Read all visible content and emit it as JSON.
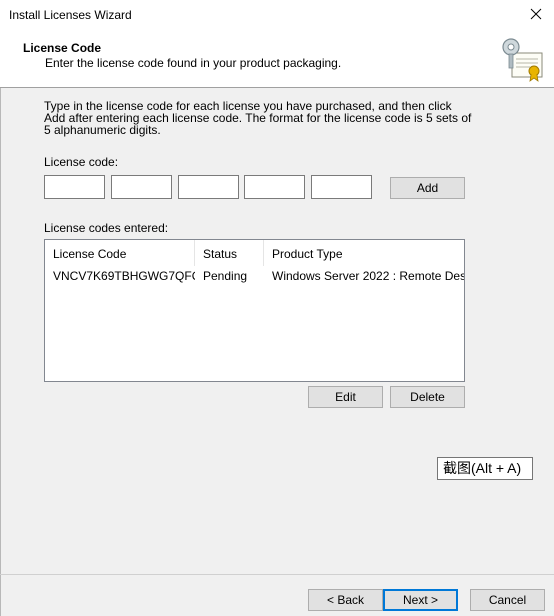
{
  "window": {
    "title": "Install Licenses Wizard"
  },
  "header": {
    "title": "License Code",
    "subtitle": "Enter the license code found in your product packaging.",
    "icon": "certificate-key-icon"
  },
  "intro": {
    "text": "Type in the license code for each license you have purchased, and then click Add after entering each license code. The format for the license code is 5 sets of 5 alphanumeric digits."
  },
  "license_code": {
    "label": "License code:",
    "segments": [
      "",
      "",
      "",
      "",
      ""
    ],
    "add_label": "Add"
  },
  "entered": {
    "label": "License codes entered:",
    "columns": [
      "License Code",
      "Status",
      "Product Type"
    ],
    "rows": [
      {
        "code": "VNCV7K69TBHGWG7QFQ...",
        "status": "Pending",
        "product": "Windows Server 2022 : Remote Des..."
      }
    ],
    "edit_label": "Edit",
    "delete_label": "Delete"
  },
  "tooltip": {
    "text": "截图(Alt + A)"
  },
  "footer": {
    "back_label": "< Back",
    "next_label": "Next >",
    "cancel_label": "Cancel"
  },
  "colors": {
    "accent": "#0078d7",
    "dialog_bg": "#f0f0f0"
  }
}
